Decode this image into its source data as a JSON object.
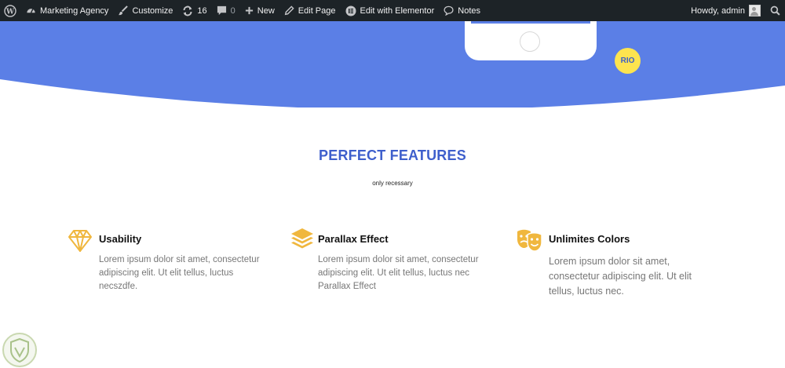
{
  "admin_bar": {
    "site_name": "Marketing Agency",
    "customize": "Customize",
    "updates_count": "16",
    "comments_count": "0",
    "new": "New",
    "edit_page": "Edit Page",
    "edit_elementor": "Edit with Elementor",
    "notes": "Notes",
    "howdy": "Howdy, admin"
  },
  "hero": {
    "badge": "RIO",
    "bg_color": "#5b7fe6",
    "badge_color": "#fde44f"
  },
  "features_section": {
    "title": "PERFECT FEATURES",
    "subtitle": "only recessary",
    "accent_color": "#3e5fcc",
    "icon_color": "#f0b73e",
    "items": [
      {
        "icon": "diamond-icon",
        "title": "Usability",
        "text": "Lorem ipsum dolor sit amet, consectetur adipiscing elit. Ut elit tellus, luctus necszdfe."
      },
      {
        "icon": "layers-icon",
        "title": "Parallax Effect",
        "text": "Lorem ipsum dolor sit amet, consectetur adipiscing elit. Ut elit tellus, luctus nec Parallax Effect"
      },
      {
        "icon": "theater-masks-icon",
        "title": "Unlimites Colors",
        "text": "Lorem ipsum dolor sit amet, consectetur adipiscing elit. Ut elit tellus, luctus nec."
      }
    ]
  }
}
